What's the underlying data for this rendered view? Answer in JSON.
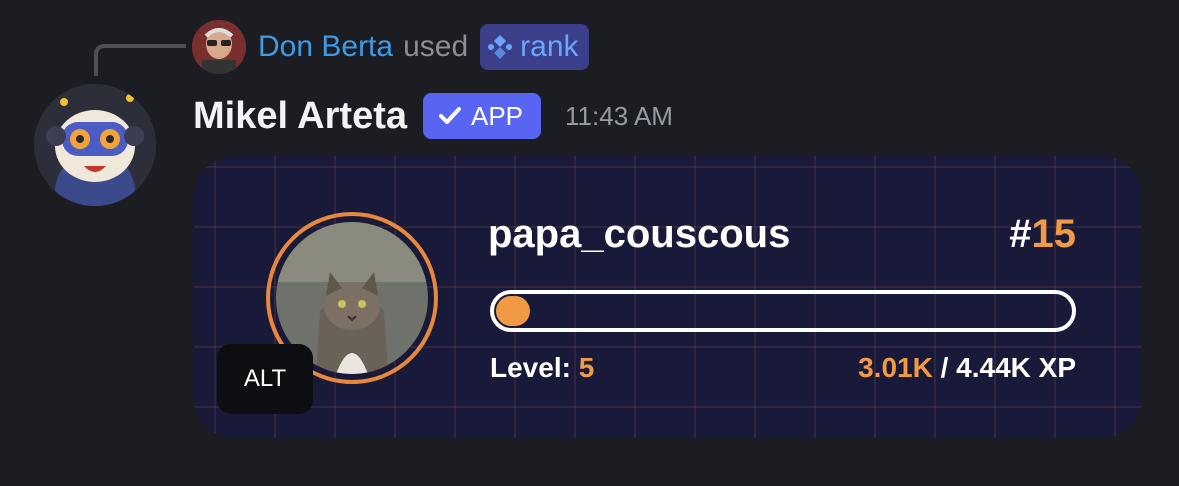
{
  "reply": {
    "user_name": "Don Berta",
    "used_text": "used",
    "command_name": "rank"
  },
  "message": {
    "author": "Mikel Arteta",
    "badge_label": "APP",
    "timestamp": "11:43 AM"
  },
  "rank_card": {
    "username": "papa_couscous",
    "rank_prefix": "#",
    "rank_value": "15",
    "progress_fraction": 0.05,
    "level_label": "Level:",
    "level_value": "5",
    "xp_current": "3.01K",
    "xp_separator": "/ 4.44K XP",
    "alt_label": "ALT"
  },
  "colors": {
    "background": "#1c1d22",
    "link_blue": "#3f9ae8",
    "app_badge": "#5865f2",
    "card_bg": "#191a3a",
    "accent_orange": "#f09a45"
  }
}
